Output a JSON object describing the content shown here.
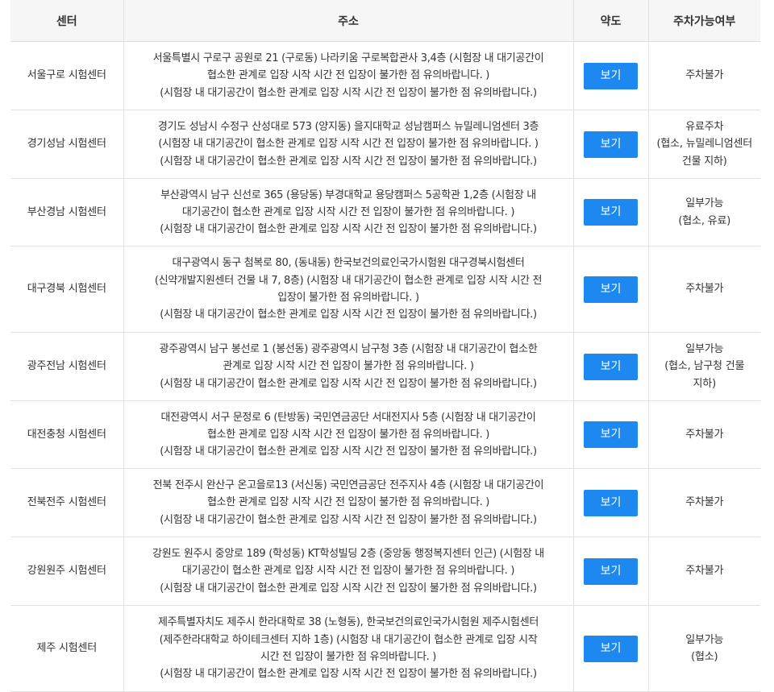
{
  "table": {
    "headers": {
      "center": "센터",
      "address": "주소",
      "map": "약도",
      "parking": "주차가능여부"
    },
    "rows": [
      {
        "center": "서울구로 시험센터",
        "address": [
          "서울특별시 구로구 공원로 21 (구로동) 나라키움 구로복합관사 3,4층 (시험장 내 대기공간이",
          "협소한 관계로 입장 시작 시간 전 입장이 불가한 점 유의바랍니다. )",
          "(시험장 내 대기공간이 협소한 관계로 입장 시작 시간 전 입장이 불가한 점 유의바랍니다.)"
        ],
        "map_button": "보기",
        "parking": [
          "주차불가"
        ]
      },
      {
        "center": "경기성남 시험센터",
        "address": [
          "경기도 성남시 수정구 산성대로 573 (양지동) 을지대학교 성남캠퍼스 뉴밀레니엄센터 3층",
          "(시험장 내 대기공간이 협소한 관계로 입장 시작 시간 전 입장이 불가한 점 유의바랍니다. )",
          "(시험장 내 대기공간이 협소한 관계로 입장 시작 시간 전 입장이 불가한 점 유의바랍니다.)"
        ],
        "map_button": "보기",
        "parking": [
          "유료주차",
          "(협소, 뉴밀레니엄센터",
          "건물 지하)"
        ]
      },
      {
        "center": "부산경남 시험센터",
        "address": [
          "부산광역시 남구 신선로 365 (용당동) 부경대학교 용당캠퍼스 5공학관 1,2층 (시험장 내",
          "대기공간이 협소한 관계로 입장 시작 시간 전 입장이 불가한 점 유의바랍니다. )",
          "(시험장 내 대기공간이 협소한 관계로 입장 시작 시간 전 입장이 불가한 점 유의바랍니다.)"
        ],
        "map_button": "보기",
        "parking": [
          "일부가능",
          "(협소, 유료)"
        ]
      },
      {
        "center": "대구경북 시험센터",
        "address": [
          "대구광역시 동구 첨복로 80, (동내동) 한국보건의료인국가시험원 대구경북시험센터",
          "(신약개발지원센터 건물 내 7, 8층) (시험장 내 대기공간이 협소한 관계로 입장 시작 시간 전",
          "입장이 불가한 점 유의바랍니다. )",
          "(시험장 내 대기공간이 협소한 관계로 입장 시작 시간 전 입장이 불가한 점 유의바랍니다.)"
        ],
        "map_button": "보기",
        "parking": [
          "주차불가"
        ]
      },
      {
        "center": "광주전남 시험센터",
        "address": [
          "광주광역시 남구 봉선로 1 (봉선동) 광주광역시 남구청 3층 (시험장 내 대기공간이 협소한",
          "관계로 입장 시작 시간 전 입장이 불가한 점 유의바랍니다. )",
          "(시험장 내 대기공간이 협소한 관계로 입장 시작 시간 전 입장이 불가한 점 유의바랍니다.)"
        ],
        "map_button": "보기",
        "parking": [
          "일부가능",
          "(협소, 남구청 건물",
          "지하)"
        ]
      },
      {
        "center": "대전충청 시험센터",
        "address": [
          "대전광역시 서구 문정로 6 (탄방동) 국민연금공단 서대전지사 5층 (시험장 내 대기공간이",
          "협소한 관계로 입장 시작 시간 전 입장이 불가한 점 유의바랍니다. )",
          "(시험장 내 대기공간이 협소한 관계로 입장 시작 시간 전 입장이 불가한 점 유의바랍니다.)"
        ],
        "map_button": "보기",
        "parking": [
          "주차불가"
        ]
      },
      {
        "center": "전북전주 시험센터",
        "address": [
          "전북 전주시 완산구 온고을로13 (서신동) 국민연금공단 전주지사 4층 (시험장 내 대기공간이",
          "협소한 관계로 입장 시작 시간 전 입장이 불가한 점 유의바랍니다. )",
          "(시험장 내 대기공간이 협소한 관계로 입장 시작 시간 전 입장이 불가한 점 유의바랍니다.)"
        ],
        "map_button": "보기",
        "parking": [
          "주차불가"
        ]
      },
      {
        "center": "강원원주 시험센터",
        "address": [
          "강원도 원주시 중앙로 189 (학성동) KT학성빌딩 2층 (중앙동 행정복지센터 인근) (시험장 내",
          "대기공간이 협소한 관계로 입장 시작 시간 전 입장이 불가한 점 유의바랍니다. )",
          "(시험장 내 대기공간이 협소한 관계로 입장 시작 시간 전 입장이 불가한 점 유의바랍니다.)"
        ],
        "map_button": "보기",
        "parking": [
          "주차불가"
        ]
      },
      {
        "center": "제주 시험센터",
        "address": [
          "제주특별자치도 제주시 한라대학로 38 (노형동), 한국보건의료인국가시험원 제주시험센터",
          "(제주한라대학교 하이테크센터 지하 1층) (시험장 내 대기공간이 협소한 관계로 입장 시작",
          "시간 전 입장이 불가한 점 유의바랍니다. )",
          "(시험장 내 대기공간이 협소한 관계로 입장 시작 시간 전 입장이 불가한 점 유의바랍니다.)"
        ],
        "map_button": "보기",
        "parking": [
          "일부가능",
          "(협소)"
        ]
      }
    ]
  },
  "colors": {
    "button": "#1c88f0",
    "header_bg": "#f6f6f6",
    "border": "#e2e2e2"
  }
}
